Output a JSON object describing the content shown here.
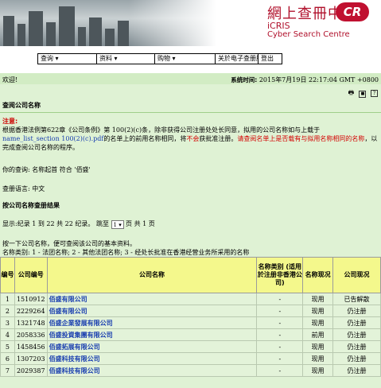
{
  "header": {
    "logo_cn": "網上查冊中心",
    "logo_badge": "CR",
    "logo_icris": "iCRIS",
    "logo_en": "Cyber Search Centre"
  },
  "menu": [
    {
      "label": "查询 ▾"
    },
    {
      "label": "资料 ▾"
    },
    {
      "label": "购物 ▾"
    },
    {
      "label": "关於电子查册服务"
    },
    {
      "label": "登出"
    }
  ],
  "status": {
    "welcome": "欢迎!",
    "systime_label": "系统时间:",
    "systime_value": "2015年7月19日 22:17:04 GMT +0800"
  },
  "toolbar_icons": [
    "print-icon",
    "save-icon",
    "help-icon"
  ],
  "page": {
    "title": "查阅公司名称",
    "notice_label": "注意:",
    "notice_part1": "根据香港法例第622章《公司条例》第 100(2)(c)条，除非获得公司注册处处长同意，拟用的公司名称如与上载于",
    "notice_link": "name_list_section 100(2)(c).pdf",
    "notice_part2": "的名单上的前用名称相同，将",
    "notice_red1": "不会",
    "notice_part3": "获批准注册。",
    "notice_red2": "请查阅名单上是否载有与拟用名称相同的名称",
    "notice_part4": "，以完成查阅公司名称的程序。",
    "query_line": "你的查询: 名称起首 符合 '佰盛'",
    "lang_line": "查册语言: 中文",
    "results_title": "按公司名称查册结果",
    "pager_prefix": "显示:纪录 1 到 22 共 22 纪录。 跳至",
    "pager_page": "1",
    "pager_suffix": "页 共 1 页",
    "tip": "按一下公司名称，便可查阅该公司的基本资料。",
    "category_legend": "名称类别: 1 - 法团名称; 2 - 其他法团名称; 3 - 经处长批准在香港经营业务所采用的名称"
  },
  "table": {
    "headers": [
      "编号",
      "公司编号",
      "公司名称",
      "名称类别 (适用於注册非香港公司)",
      "名称现况",
      "公司现况"
    ],
    "rows": [
      {
        "no": "1",
        "cr": "1510912",
        "name": "佰盛有限公司",
        "cat": "-",
        "name_status": "现用",
        "co_status": "已告解散"
      },
      {
        "no": "2",
        "cr": "2229264",
        "name": "佰盛有限公司",
        "cat": "-",
        "name_status": "现用",
        "co_status": "仍注册"
      },
      {
        "no": "3",
        "cr": "1321748",
        "name": "佰盛企業發展有限公司",
        "cat": "-",
        "name_status": "现用",
        "co_status": "仍注册"
      },
      {
        "no": "4",
        "cr": "2058336",
        "name": "佰盛投資集團有限公司",
        "cat": "-",
        "name_status": "前用",
        "co_status": "仍注册"
      },
      {
        "no": "5",
        "cr": "1458456",
        "name": "佰盛拓展有限公司",
        "cat": "-",
        "name_status": "现用",
        "co_status": "仍注册"
      },
      {
        "no": "6",
        "cr": "1307203",
        "name": "佰盛科技有限公司",
        "cat": "-",
        "name_status": "现用",
        "co_status": "仍注册"
      },
      {
        "no": "7",
        "cr": "2029387",
        "name": "佰盛科技有限公司",
        "cat": "-",
        "name_status": "现用",
        "co_status": "仍注册"
      }
    ]
  },
  "colors": {
    "accent_red": "#b0102b",
    "link_blue": "#1a3fb0",
    "content_bg": "#dff2d4",
    "header_yellow": "#f4f88c"
  }
}
